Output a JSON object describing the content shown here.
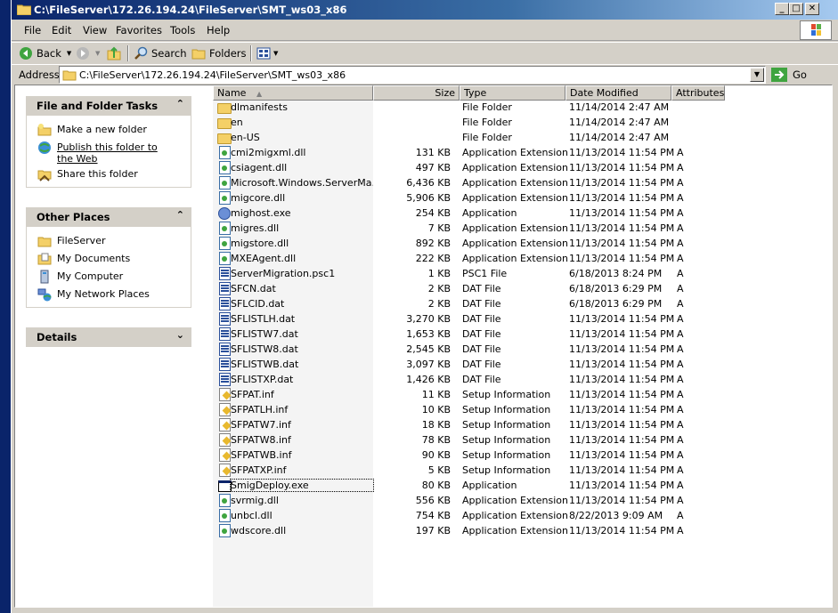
{
  "window": {
    "title": "C:\\FileServer\\172.26.194.24\\FileServer\\SMT_ws03_x86",
    "minimize_label": "_",
    "maximize_label": "□",
    "close_label": "✕"
  },
  "menu": {
    "items": [
      {
        "label": "File"
      },
      {
        "label": "Edit"
      },
      {
        "label": "View"
      },
      {
        "label": "Favorites"
      },
      {
        "label": "Tools"
      },
      {
        "label": "Help"
      }
    ]
  },
  "toolbar": {
    "back_label": "Back",
    "search_label": "Search",
    "folders_label": "Folders"
  },
  "address": {
    "label": "Address",
    "value": "C:\\FileServer\\172.26.194.24\\FileServer\\SMT_ws03_x86",
    "go_label": "Go"
  },
  "tasks": {
    "file_folder": {
      "title": "File and Folder Tasks",
      "items": [
        {
          "label": "Make a new folder",
          "icon": "new-folder-icon"
        },
        {
          "label": "Publish this folder to the Web",
          "icon": "publish-web-icon"
        },
        {
          "label": "Share this folder",
          "icon": "share-folder-icon"
        }
      ]
    },
    "other_places": {
      "title": "Other Places",
      "items": [
        {
          "label": "FileServer",
          "icon": "folder-icon"
        },
        {
          "label": "My Documents",
          "icon": "my-documents-icon"
        },
        {
          "label": "My Computer",
          "icon": "my-computer-icon"
        },
        {
          "label": "My Network Places",
          "icon": "network-places-icon"
        }
      ]
    },
    "details": {
      "title": "Details"
    }
  },
  "columns": {
    "name": "Name",
    "size": "Size",
    "type": "Type",
    "date": "Date Modified",
    "attr": "Attributes"
  },
  "files": [
    {
      "name": "dlmanifests",
      "size": "",
      "type": "File Folder",
      "date": "11/14/2014 2:47 AM",
      "attr": "",
      "icon": "folder"
    },
    {
      "name": "en",
      "size": "",
      "type": "File Folder",
      "date": "11/14/2014 2:47 AM",
      "attr": "",
      "icon": "folder"
    },
    {
      "name": "en-US",
      "size": "",
      "type": "File Folder",
      "date": "11/14/2014 2:47 AM",
      "attr": "",
      "icon": "folder"
    },
    {
      "name": "cmi2migxml.dll",
      "size": "131 KB",
      "type": "Application Extension",
      "date": "11/13/2014 11:54 PM",
      "attr": "A",
      "icon": "dll"
    },
    {
      "name": "csiagent.dll",
      "size": "497 KB",
      "type": "Application Extension",
      "date": "11/13/2014 11:54 PM",
      "attr": "A",
      "icon": "dll"
    },
    {
      "name": "Microsoft.Windows.ServerMa...",
      "size": "6,436 KB",
      "type": "Application Extension",
      "date": "11/13/2014 11:54 PM",
      "attr": "A",
      "icon": "dll"
    },
    {
      "name": "migcore.dll",
      "size": "5,906 KB",
      "type": "Application Extension",
      "date": "11/13/2014 11:54 PM",
      "attr": "A",
      "icon": "dll"
    },
    {
      "name": "mighost.exe",
      "size": "254 KB",
      "type": "Application",
      "date": "11/13/2014 11:54 PM",
      "attr": "A",
      "icon": "exe"
    },
    {
      "name": "migres.dll",
      "size": "7 KB",
      "type": "Application Extension",
      "date": "11/13/2014 11:54 PM",
      "attr": "A",
      "icon": "dll"
    },
    {
      "name": "migstore.dll",
      "size": "892 KB",
      "type": "Application Extension",
      "date": "11/13/2014 11:54 PM",
      "attr": "A",
      "icon": "dll"
    },
    {
      "name": "MXEAgent.dll",
      "size": "222 KB",
      "type": "Application Extension",
      "date": "11/13/2014 11:54 PM",
      "attr": "A",
      "icon": "dll"
    },
    {
      "name": "ServerMigration.psc1",
      "size": "1 KB",
      "type": "PSC1 File",
      "date": "6/18/2013 8:24 PM",
      "attr": "A",
      "icon": "dat"
    },
    {
      "name": "SFCN.dat",
      "size": "2 KB",
      "type": "DAT File",
      "date": "6/18/2013 6:29 PM",
      "attr": "A",
      "icon": "dat"
    },
    {
      "name": "SFLCID.dat",
      "size": "2 KB",
      "type": "DAT File",
      "date": "6/18/2013 6:29 PM",
      "attr": "A",
      "icon": "dat"
    },
    {
      "name": "SFLISTLH.dat",
      "size": "3,270 KB",
      "type": "DAT File",
      "date": "11/13/2014 11:54 PM",
      "attr": "A",
      "icon": "dat"
    },
    {
      "name": "SFLISTW7.dat",
      "size": "1,653 KB",
      "type": "DAT File",
      "date": "11/13/2014 11:54 PM",
      "attr": "A",
      "icon": "dat"
    },
    {
      "name": "SFLISTW8.dat",
      "size": "2,545 KB",
      "type": "DAT File",
      "date": "11/13/2014 11:54 PM",
      "attr": "A",
      "icon": "dat"
    },
    {
      "name": "SFLISTWB.dat",
      "size": "3,097 KB",
      "type": "DAT File",
      "date": "11/13/2014 11:54 PM",
      "attr": "A",
      "icon": "dat"
    },
    {
      "name": "SFLISTXP.dat",
      "size": "1,426 KB",
      "type": "DAT File",
      "date": "11/13/2014 11:54 PM",
      "attr": "A",
      "icon": "dat"
    },
    {
      "name": "SFPAT.inf",
      "size": "11 KB",
      "type": "Setup Information",
      "date": "11/13/2014 11:54 PM",
      "attr": "A",
      "icon": "inf"
    },
    {
      "name": "SFPATLH.inf",
      "size": "10 KB",
      "type": "Setup Information",
      "date": "11/13/2014 11:54 PM",
      "attr": "A",
      "icon": "inf"
    },
    {
      "name": "SFPATW7.inf",
      "size": "18 KB",
      "type": "Setup Information",
      "date": "11/13/2014 11:54 PM",
      "attr": "A",
      "icon": "inf"
    },
    {
      "name": "SFPATW8.inf",
      "size": "78 KB",
      "type": "Setup Information",
      "date": "11/13/2014 11:54 PM",
      "attr": "A",
      "icon": "inf"
    },
    {
      "name": "SFPATWB.inf",
      "size": "90 KB",
      "type": "Setup Information",
      "date": "11/13/2014 11:54 PM",
      "attr": "A",
      "icon": "inf"
    },
    {
      "name": "SFPATXP.inf",
      "size": "5 KB",
      "type": "Setup Information",
      "date": "11/13/2014 11:54 PM",
      "attr": "A",
      "icon": "inf"
    },
    {
      "name": "SmigDeploy.exe",
      "size": "80 KB",
      "type": "Application",
      "date": "11/13/2014 11:54 PM",
      "attr": "A",
      "icon": "app",
      "selected": true
    },
    {
      "name": "svrmig.dll",
      "size": "556 KB",
      "type": "Application Extension",
      "date": "11/13/2014 11:54 PM",
      "attr": "A",
      "icon": "dll"
    },
    {
      "name": "unbcl.dll",
      "size": "754 KB",
      "type": "Application Extension",
      "date": "8/22/2013 9:09 AM",
      "attr": "A",
      "icon": "dll"
    },
    {
      "name": "wdscore.dll",
      "size": "197 KB",
      "type": "Application Extension",
      "date": "11/13/2014 11:54 PM",
      "attr": "A",
      "icon": "dll"
    }
  ]
}
